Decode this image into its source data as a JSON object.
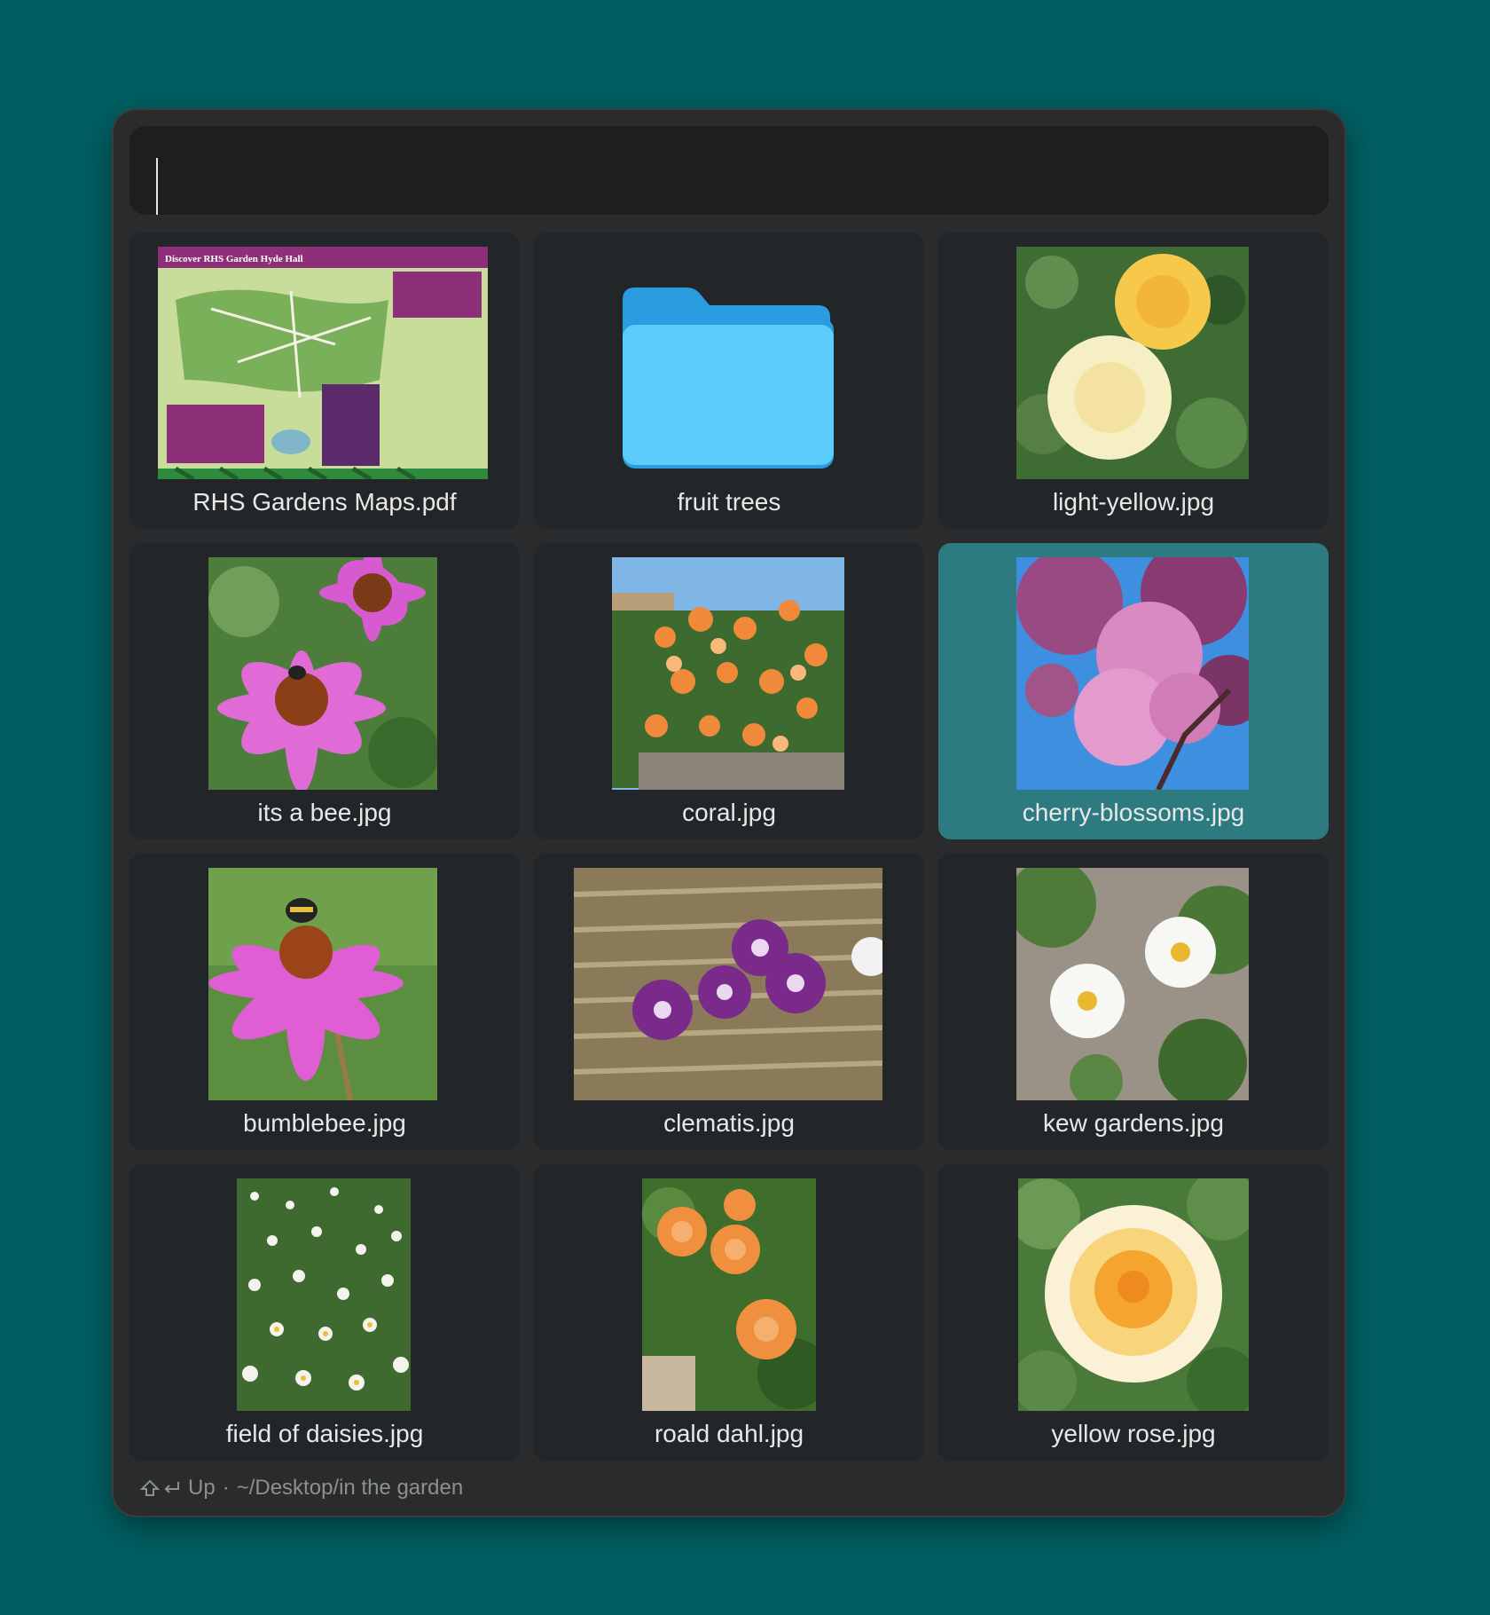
{
  "search": {
    "value": "",
    "placeholder": ""
  },
  "items": [
    {
      "name": "RHS Gardens Maps.pdf",
      "kind": "pdf",
      "thumb_title": "Discover RHS Garden Hyde Hall"
    },
    {
      "name": "fruit trees",
      "kind": "folder"
    },
    {
      "name": "light-yellow.jpg",
      "kind": "image",
      "subject": "yellow and white roses"
    },
    {
      "name": "its a bee.jpg",
      "kind": "image",
      "subject": "pink coneflowers with bee"
    },
    {
      "name": "coral.jpg",
      "kind": "image",
      "subject": "coral rose bush"
    },
    {
      "name": "cherry-blossoms.jpg",
      "kind": "image",
      "subject": "pink cherry blossoms",
      "selected": true
    },
    {
      "name": "bumblebee.jpg",
      "kind": "image",
      "subject": "coneflower with bumblebee"
    },
    {
      "name": "clematis.jpg",
      "kind": "image",
      "subject": "purple clematis on wicker fence"
    },
    {
      "name": "kew gardens.jpg",
      "kind": "image",
      "subject": "white wild roses"
    },
    {
      "name": "field of daisies.jpg",
      "kind": "image",
      "subject": "daisies"
    },
    {
      "name": "roald dahl.jpg",
      "kind": "image",
      "subject": "orange roses"
    },
    {
      "name": "yellow rose.jpg",
      "kind": "image",
      "subject": "yellow rose"
    }
  ],
  "status": {
    "up_label": "Up",
    "separator": "·",
    "path": "~/Desktop/in the garden"
  },
  "colors": {
    "background": "#005f62",
    "window": "#2a2b2c",
    "tile": "#222628",
    "selected": "#2d7b80",
    "folder": "#4fc1f7"
  },
  "icons": {
    "shift": "shift-icon",
    "return": "return-icon"
  }
}
